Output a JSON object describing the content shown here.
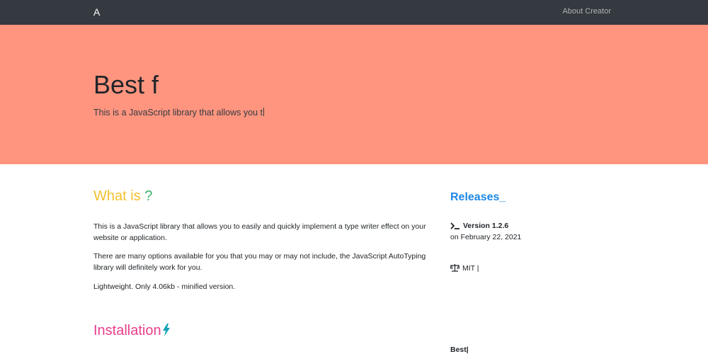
{
  "navbar": {
    "brand": "A",
    "about_link": "About Creator"
  },
  "hero": {
    "title": "Best f",
    "subtitle": "This is a JavaScript library that allows you t"
  },
  "main": {
    "what_is": {
      "heading_text": "What is ",
      "heading_mark": "?"
    },
    "paragraphs": [
      "This is a JavaScript library that allows you to easily and quickly implement a type writer effect on your website or application.",
      "There are many options available for you that you may or may not include, the JavaScript AutoTyping library will definitely work for you.",
      "Lightweight. Only 4.06kb - minified version."
    ],
    "installation_heading": "Installation"
  },
  "sidebar": {
    "releases_heading": "Releases_",
    "version": "Version 1.2.6",
    "date": "on February 22, 2021",
    "license": "MIT |",
    "best": "Best|"
  },
  "icons": {
    "terminal": "terminal-icon",
    "scale": "balance-scale-icon",
    "bolt": "lightning-bolt-icon"
  },
  "colors": {
    "navbar_bg": "#343a40",
    "hero_bg": "#ff957f",
    "what_heading": "#f2c12e",
    "question_mark": "#3db36a",
    "installation_heading": "#e83e8c",
    "bolt": "#17a2b8",
    "releases_heading": "#1e88e5"
  }
}
